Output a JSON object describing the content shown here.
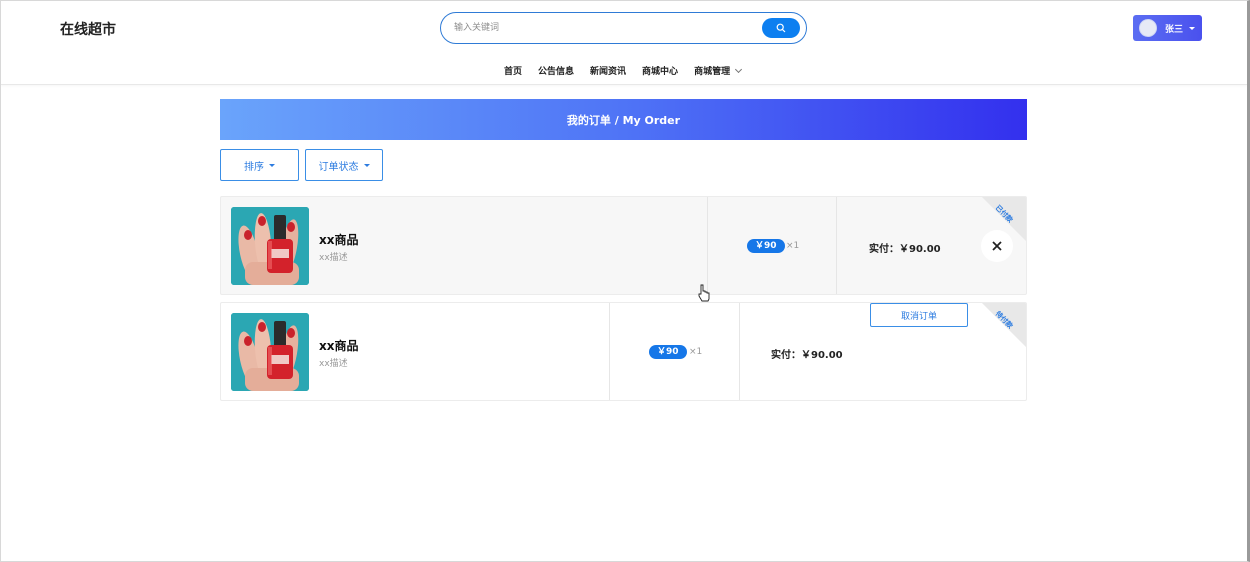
{
  "header": {
    "brand": "在线超市",
    "search_placeholder": "输入关键词",
    "user_name": "张三"
  },
  "nav": {
    "items": [
      "首页",
      "公告信息",
      "新闻资讯",
      "商城中心"
    ],
    "dropdown_label": "商城管理"
  },
  "banner": {
    "title": "我的订单 / My Order"
  },
  "filters": {
    "sort_label": "排序",
    "status_label": "订单状态"
  },
  "orders": [
    {
      "name": "xx商品",
      "desc": "xx描述",
      "price": "￥90",
      "qty": "×1",
      "paid": "实付：￥90.00",
      "status": "已付款"
    },
    {
      "name": "xx商品",
      "desc": "xx描述",
      "price": "￥90",
      "qty": "×1",
      "paid": "实付：￥90.00",
      "status": "待付款",
      "cancel_label": "取消订单"
    }
  ],
  "colors": {
    "accent": "#0d7ff0",
    "banner_start": "#6aa4fb",
    "banner_end": "#3330ee"
  }
}
